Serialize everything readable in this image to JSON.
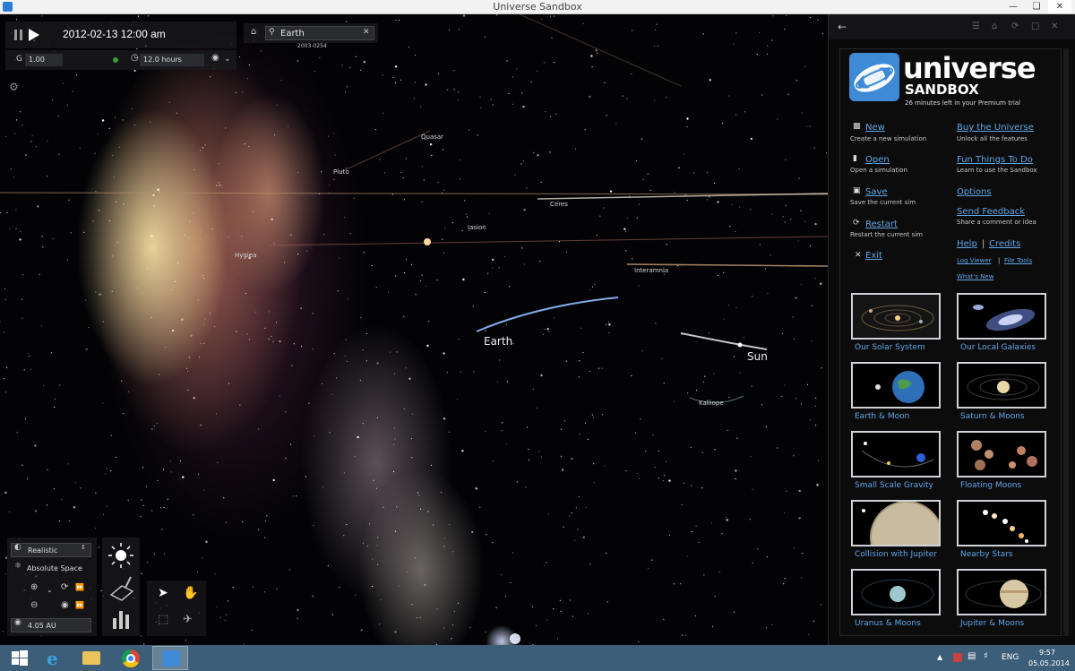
{
  "window": {
    "title": "Universe Sandbox"
  },
  "hud": {
    "date": "2012-02-13 12:00 am",
    "g_label": "G",
    "g_value": "1.00",
    "timestep": "12.0 hours",
    "search_value": "Earth",
    "search_sub": "2003-0254",
    "view_mode": "Realistic",
    "space_mode": "Absolute Space",
    "distance": "4.05 AU"
  },
  "space_labels": {
    "quasar": "Quasar",
    "pluto": "Pluto",
    "ceres": "Ceres",
    "iasion": "Iasion",
    "hygiea": "Hygiea",
    "interamnia": "Interamnia",
    "earth": "Earth",
    "sun": "Sun",
    "kalliope": "Kalliope"
  },
  "panel": {
    "logo_title": "universe",
    "logo_sub": "SANDBOX",
    "trial_text": "26 minutes left in your Premium trial",
    "menu_left": [
      {
        "label": "New",
        "desc": "Create a new simulation"
      },
      {
        "label": "Open",
        "desc": "Open a simulation"
      },
      {
        "label": "Save",
        "desc": "Save the current sim"
      },
      {
        "label": "Restart",
        "desc": "Restart the current sim"
      },
      {
        "label": "Exit",
        "desc": ""
      }
    ],
    "menu_right": [
      {
        "label": "Buy the Universe",
        "desc": "Unlock all the features"
      },
      {
        "label": "Fun Things To Do",
        "desc": "Learn to use the Sandbox"
      },
      {
        "label": "Options",
        "desc": ""
      },
      {
        "label": "Send Feedback",
        "desc": "Share a comment or idea"
      }
    ],
    "help": "Help",
    "separator": "|",
    "credits": "Credits",
    "log_viewer": "Log Viewer",
    "file_tools": "File Tools",
    "whats_new": "What's New",
    "thumbnails": [
      "Our Solar System",
      "Our Local Galaxies",
      "Earth & Moon",
      "Saturn & Moons",
      "Small Scale Gravity",
      "Floating Moons",
      "Collision with Jupiter",
      "Nearby Stars",
      "Uranus & Moons",
      "Jupiter & Moons"
    ]
  },
  "taskbar": {
    "lang": "ENG",
    "time": "9:57",
    "date": "05.05.2014"
  }
}
